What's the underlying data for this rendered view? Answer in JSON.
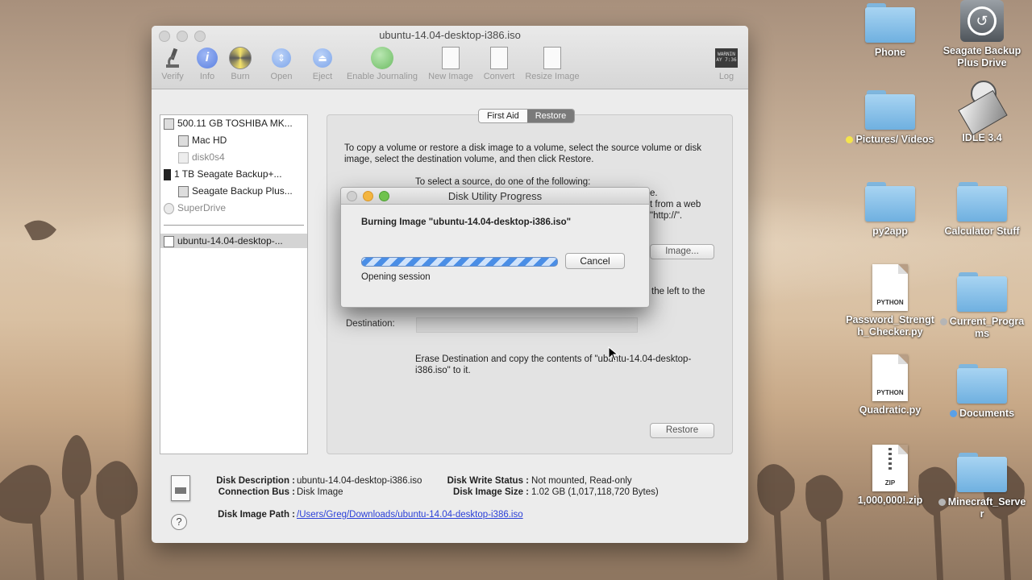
{
  "desktop": {
    "icons": [
      {
        "label": "Phone"
      },
      {
        "label": "Seagate Backup Plus Drive"
      },
      {
        "label": "Pictures/ Videos"
      },
      {
        "label": "IDLE 3.4"
      },
      {
        "label": "py2app"
      },
      {
        "label": "Calculator Stuff"
      },
      {
        "label": "Password_Strength_Checker.py",
        "type_label": "PYTHON"
      },
      {
        "label": "Current_Programs"
      },
      {
        "label": "Quadratic.py",
        "type_label": "PYTHON"
      },
      {
        "label": "Documents"
      },
      {
        "label": "1,000,000!.zip",
        "type_label": "ZIP"
      },
      {
        "label": "Minecraft_Server"
      }
    ]
  },
  "window": {
    "title": "ubuntu-14.04-desktop-i386.iso",
    "toolbar": {
      "verify": "Verify",
      "info": "Info",
      "burn": "Burn",
      "open": "Open",
      "eject": "Eject",
      "enable_journaling": "Enable Journaling",
      "new_image": "New Image",
      "convert": "Convert",
      "resize_image": "Resize Image",
      "log": "Log",
      "log_badge": "WARNIN\nAY 7:36"
    },
    "sidebar": {
      "items": [
        {
          "label": "500.11 GB TOSHIBA MK..."
        },
        {
          "label": "Mac HD"
        },
        {
          "label": "disk0s4"
        },
        {
          "label": "1 TB Seagate Backup+..."
        },
        {
          "label": "Seagate Backup Plus..."
        },
        {
          "label": "SuperDrive"
        },
        {
          "label": "ubuntu-14.04-desktop-..."
        }
      ]
    },
    "tabs": {
      "first_aid": "First Aid",
      "restore": "Restore"
    },
    "restore": {
      "intro": "To copy a volume or restore a disk image to a volume, select the source volume or disk image, select the destination volume, and then click Restore.",
      "select_source": "To select a source, do one of the following:",
      "frag_e": "e.",
      "frag_web": "t from a web",
      "frag_http": "\"http://\".",
      "image_button": "Image...",
      "frag_left": "the left to the",
      "destination_label": "Destination:",
      "erase_text": "Erase Destination and copy the contents of \"ubuntu-14.04-desktop-i386.iso\" to it.",
      "restore_button": "Restore"
    },
    "info": {
      "disk_description_label": "Disk Description :",
      "disk_description": "ubuntu-14.04-desktop-i386.iso",
      "connection_bus_label": "Connection Bus :",
      "connection_bus": "Disk Image",
      "disk_write_status_label": "Disk Write Status :",
      "disk_write_status": "Not mounted, Read-only",
      "disk_image_size_label": "Disk Image Size :",
      "disk_image_size": "1.02 GB (1,017,118,720 Bytes)",
      "disk_image_path_label": "Disk Image Path :",
      "disk_image_path": "/Users/Greg/Downloads/ubuntu-14.04-desktop-i386.iso",
      "help": "?"
    }
  },
  "dialog": {
    "title": "Disk Utility Progress",
    "heading": "Burning Image \"ubuntu-14.04-desktop-i386.iso\"",
    "status": "Opening session",
    "cancel": "Cancel",
    "progress": 1.0
  }
}
